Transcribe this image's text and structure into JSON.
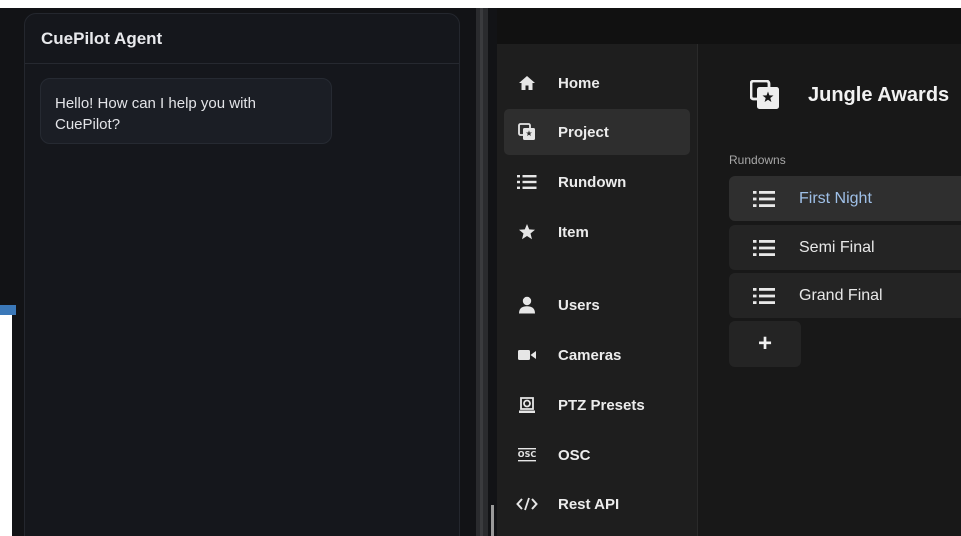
{
  "agent": {
    "title": "CuePilot Agent",
    "message": "Hello! How can I help you with CuePilot?"
  },
  "sidebar": {
    "items": [
      {
        "label": "Home",
        "icon": "home-icon"
      },
      {
        "label": "Project",
        "icon": "project-icon",
        "active": true
      },
      {
        "label": "Rundown",
        "icon": "list-icon"
      },
      {
        "label": "Item",
        "icon": "star-icon"
      },
      {
        "label": "Users",
        "icon": "user-icon"
      },
      {
        "label": "Cameras",
        "icon": "camera-icon"
      },
      {
        "label": "PTZ Presets",
        "icon": "ptz-icon"
      },
      {
        "label": "OSC",
        "icon": "osc-icon"
      },
      {
        "label": "Rest API",
        "icon": "code-icon"
      }
    ]
  },
  "project": {
    "title": "Jungle Awards",
    "rundowns_label": "Rundowns",
    "rundowns": [
      {
        "label": "First Night",
        "active": true
      },
      {
        "label": "Semi Final"
      },
      {
        "label": "Grand Final"
      }
    ],
    "add_label": "+"
  },
  "colors": {
    "accent_text": "#9fc0e8",
    "agent_bg": "#15171c",
    "app_bg": "#1b1b1b"
  }
}
